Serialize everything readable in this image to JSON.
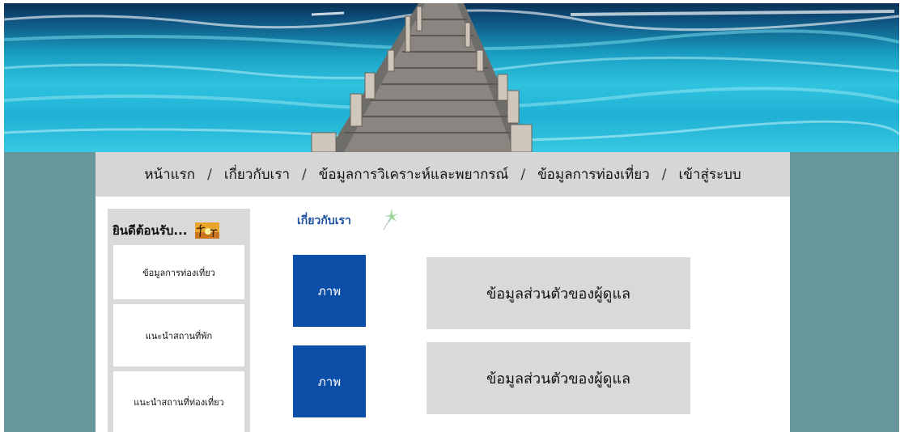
{
  "nav": {
    "items": [
      {
        "label": "หน้าแรก"
      },
      {
        "label": "เกี่ยวกับเรา"
      },
      {
        "label": "ข้อมูลการวิเคราะห์และพยากรณ์"
      },
      {
        "label": "ข้อมูลการท่องเที่ยว"
      },
      {
        "label": "เข้าสู่ระบบ"
      }
    ],
    "separator": "/"
  },
  "sidebar": {
    "welcome": "ยินดีต้อนรับ...",
    "items": [
      {
        "label": "ข้อมูลการท่องเที่ยว"
      },
      {
        "label": "แนะนำสถานที่พัก"
      },
      {
        "label": "แนะนำสถานที่ท่องเที่ยว"
      }
    ]
  },
  "about": {
    "title": "เกี่ยวกับเรา",
    "cards": [
      {
        "photo": "ภาพ",
        "info": "ข้อมูลส่วนตัวของผู้ดูแล"
      },
      {
        "photo": "ภาพ",
        "info": "ข้อมูลส่วนตัวของผู้ดูแล"
      }
    ]
  },
  "colors": {
    "frame": "#67979b",
    "navbar": "#d6d6d6",
    "photo": "#0b4fa8",
    "title": "#1a4fa0"
  }
}
